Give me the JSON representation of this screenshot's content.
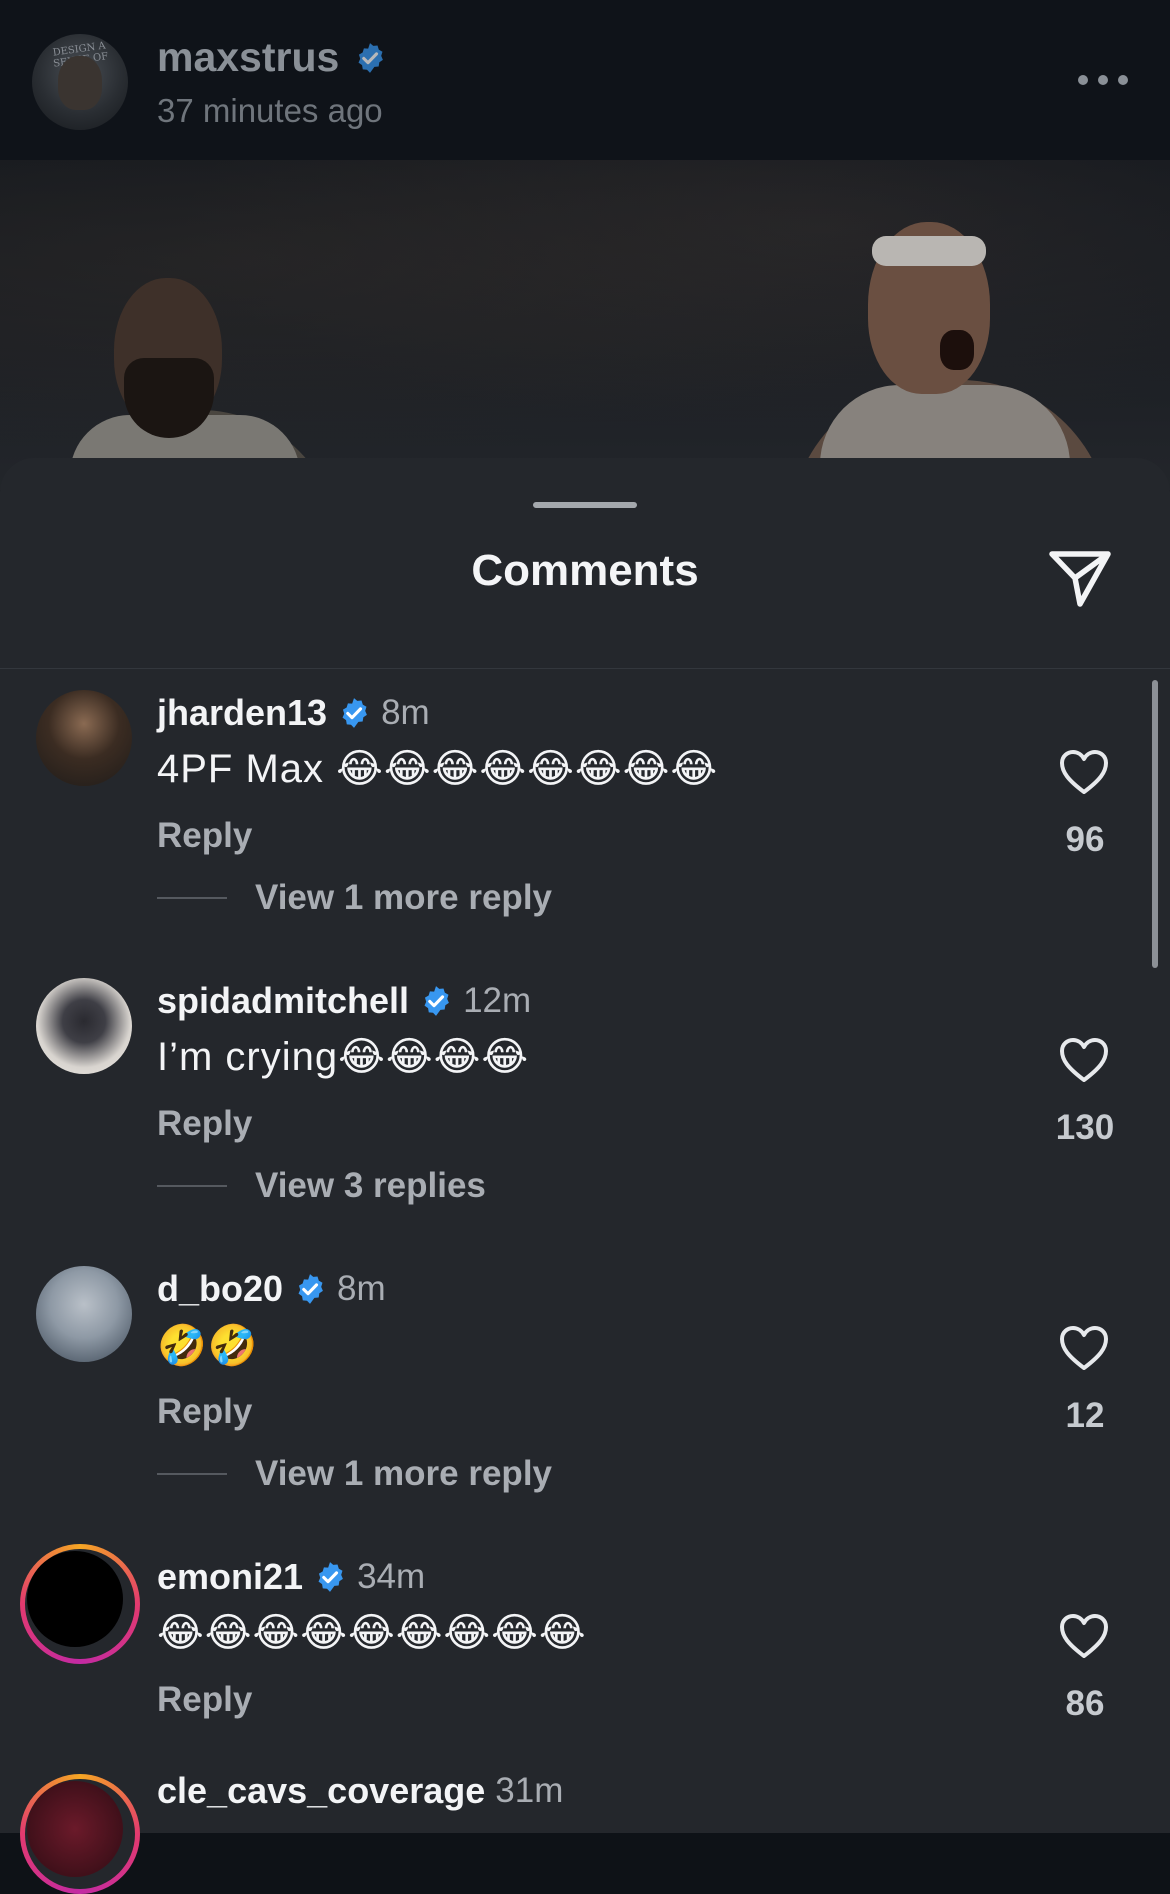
{
  "post": {
    "username": "maxstrus",
    "time": "37 minutes ago",
    "avatar_text": "DESIGN A SENSE OF"
  },
  "sheet": {
    "title": "Comments"
  },
  "comments": [
    {
      "username": "jharden13",
      "verified": true,
      "time": "8m",
      "text": "4PF Max 😂😂😂😂😂😂😂😂",
      "reply_label": "Reply",
      "view_replies": "View 1 more reply",
      "likes": "96"
    },
    {
      "username": "spidadmitchell",
      "verified": true,
      "time": "12m",
      "text": "I’m crying😂😂😂😂",
      "reply_label": "Reply",
      "view_replies": "View 3 replies",
      "likes": "130"
    },
    {
      "username": "d_bo20",
      "verified": true,
      "time": "8m",
      "text": "🤣🤣",
      "reply_label": "Reply",
      "view_replies": "View 1 more reply",
      "likes": "12"
    },
    {
      "username": "emoni21",
      "verified": true,
      "time": "34m",
      "text": "😂😂😂😂😂😂😂😂😂",
      "reply_label": "Reply",
      "view_replies": "",
      "likes": "86"
    },
    {
      "username": "cle_cavs_coverage",
      "verified": false,
      "time": "31m",
      "text": "",
      "reply_label": "",
      "view_replies": "",
      "likes": ""
    }
  ],
  "colors": {
    "verified": "#3897f0",
    "sheet_bg": "#24272c",
    "story_ring": [
      "#f5a623",
      "#e23a6f",
      "#c32aa3"
    ]
  },
  "icons": {
    "more": "more-dots-icon",
    "send": "send-icon",
    "like": "heart-icon",
    "verified": "verified-badge-icon"
  }
}
